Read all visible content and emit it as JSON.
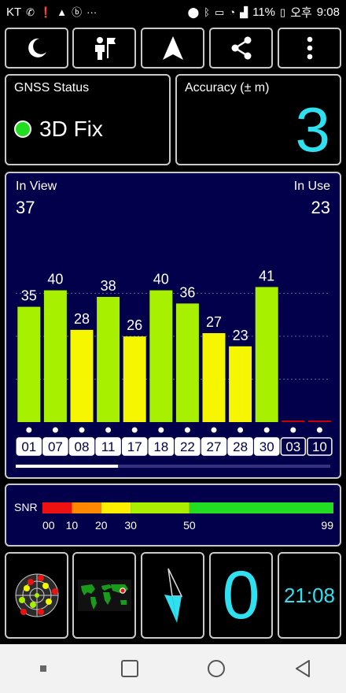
{
  "statusbar": {
    "carrier": "KT",
    "battery": "11%",
    "ampm": "오후",
    "time": "9:08"
  },
  "toolbar": {
    "icons": [
      "moon-icon",
      "person-flag-icon",
      "navigation-arrow-icon",
      "share-icon",
      "more-vert-icon"
    ]
  },
  "gnss": {
    "title": "GNSS Status",
    "fix": "3D Fix",
    "fix_color": "#22dd22"
  },
  "accuracy": {
    "title": "Accuracy (± m)",
    "value": "3",
    "color": "#2fe0f0"
  },
  "satellites": {
    "in_view_label": "In View",
    "in_view": "37",
    "in_use_label": "In Use",
    "in_use": "23"
  },
  "chart_data": {
    "type": "bar",
    "categories": [
      "01",
      "07",
      "08",
      "11",
      "17",
      "18",
      "22",
      "27",
      "28",
      "30",
      "03",
      "10"
    ],
    "values": [
      35,
      40,
      28,
      38,
      26,
      40,
      36,
      27,
      23,
      41,
      0,
      0
    ],
    "labels": [
      "35",
      "40",
      "28",
      "38",
      "26",
      "40",
      "36",
      "27",
      "23",
      "41",
      "",
      ""
    ],
    "in_use": [
      true,
      true,
      true,
      true,
      true,
      true,
      true,
      true,
      true,
      true,
      false,
      false
    ],
    "ylim": [
      0,
      99
    ],
    "grid": true,
    "colors": {
      "green": "#a6f000",
      "yellow": "#f6f600",
      "background": "#02004a"
    }
  },
  "snr": {
    "label": "SNR",
    "ticks": [
      "00",
      "10",
      "20",
      "30",
      "50",
      "99"
    ],
    "colors": [
      "#ee1111",
      "#ff8800",
      "#ffee00",
      "#aaee00",
      "#22dd22"
    ]
  },
  "bottom": {
    "speed": "0",
    "clock": "21:08",
    "speed_color": "#2fe0f0",
    "clock_color": "#2fe0f0"
  }
}
